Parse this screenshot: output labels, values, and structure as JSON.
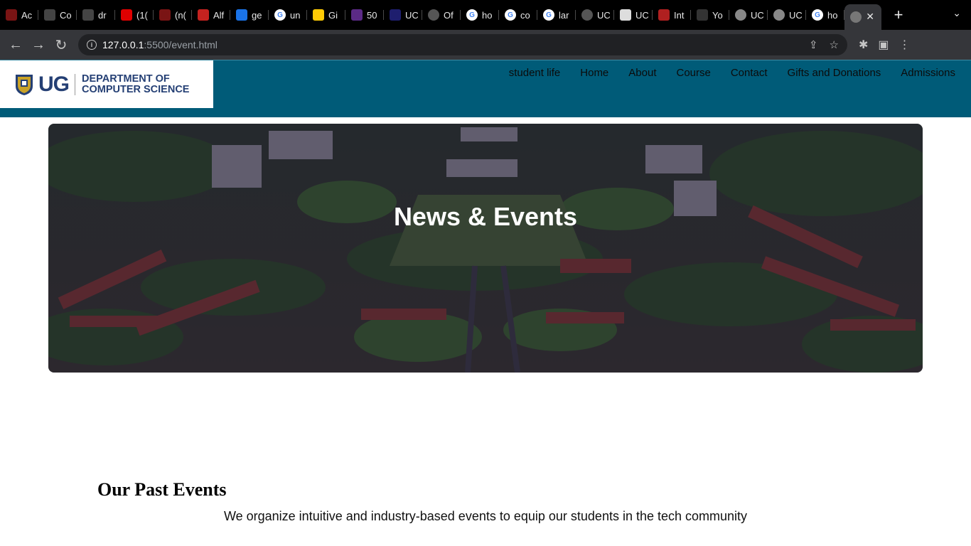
{
  "browser": {
    "tabs": [
      {
        "title": "Ac",
        "favicon": "red-gear-icon",
        "color": "#7a1414"
      },
      {
        "title": "Co",
        "favicon": "github-icon",
        "color": "#444444"
      },
      {
        "title": "dr",
        "favicon": "github-icon",
        "color": "#444444"
      },
      {
        "title": "(1(",
        "favicon": "youtube-icon",
        "color": "#e00000"
      },
      {
        "title": "(n(",
        "favicon": "gmail-icon",
        "color": "#7a1414"
      },
      {
        "title": "Alf",
        "favicon": "gmail-icon",
        "color": "#c5221f"
      },
      {
        "title": "ge",
        "favicon": "search-icon",
        "color": "#1a73e8"
      },
      {
        "title": "un",
        "favicon": "google-icon",
        "color": "#ffffff"
      },
      {
        "title": "Gi",
        "favicon": "michigan-icon",
        "color": "#ffcb05"
      },
      {
        "title": "50",
        "favicon": "grid-icon",
        "color": "#5b2a86"
      },
      {
        "title": "UC",
        "favicon": "dots-icon",
        "color": "#1e1e6e"
      },
      {
        "title": "Of",
        "favicon": "globe-icon",
        "color": "#555555"
      },
      {
        "title": "ho",
        "favicon": "google-icon",
        "color": "#ffffff"
      },
      {
        "title": "co",
        "favicon": "google-icon",
        "color": "#ffffff"
      },
      {
        "title": "lar",
        "favicon": "google-icon",
        "color": "#ffffff"
      },
      {
        "title": "UC",
        "favicon": "globe-icon",
        "color": "#555555"
      },
      {
        "title": "UC",
        "favicon": "page-icon",
        "color": "#dddddd"
      },
      {
        "title": "Int",
        "favicon": "crest-icon",
        "color": "#b02020"
      },
      {
        "title": "Yo",
        "favicon": "arrow-icon",
        "color": "#333333"
      },
      {
        "title": "UC",
        "favicon": "globe-icon",
        "color": "#888888"
      },
      {
        "title": "UC",
        "favicon": "globe-icon",
        "color": "#888888"
      },
      {
        "title": "ho",
        "favicon": "google-icon",
        "color": "#ffffff"
      }
    ],
    "active_tab": {
      "title": "",
      "favicon": "globe-icon"
    },
    "url_host": "127.0.0.1",
    "url_path": ":5500/event.html"
  },
  "site": {
    "logo_ug": "UG",
    "logo_dept_line1": "DEPARTMENT OF",
    "logo_dept_line2": "COMPUTER SCIENCE",
    "nav": [
      "student life",
      "Home",
      "About",
      "Course",
      "Contact",
      "Gifts and Donations",
      "Admissions"
    ],
    "hero_title": "News & Events",
    "past_title": "Our Past Events",
    "past_subtitle": "We organize intuitive and industry-based events to equip our students in the tech community"
  },
  "colors": {
    "header": "#005b78",
    "logo_text": "#243f74",
    "chrome_bg": "#35363a"
  }
}
